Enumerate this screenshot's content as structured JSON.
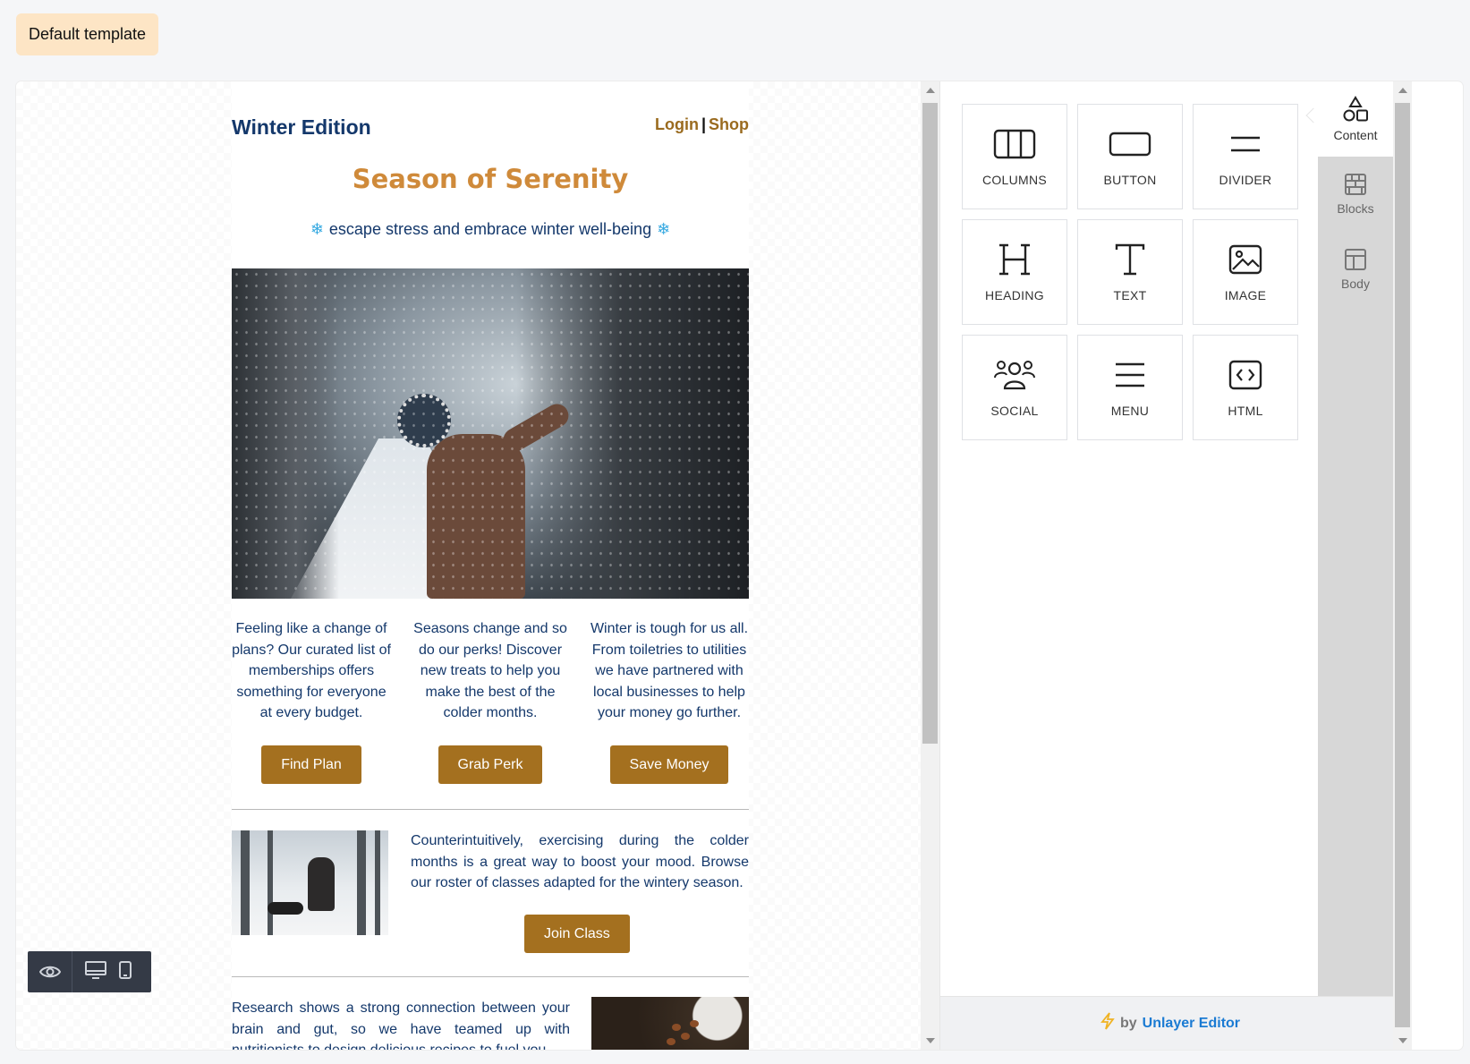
{
  "header": {
    "template_label": "Default template"
  },
  "email": {
    "brand": "Winter Edition",
    "login_link": "Login",
    "separator": "|",
    "shop_link": "Shop",
    "headline": "Season of Serenity",
    "tagline": "escape stress and embrace winter well-being",
    "tagline_icon": "❄",
    "columns": [
      {
        "text": "Feeling like a change of plans? Our curated list of memberships offers something for everyone at every budget.",
        "button": "Find Plan"
      },
      {
        "text": "Seasons change and so do our perks! Discover new treats to help you make the best of the colder months.",
        "button": "Grab Perk"
      },
      {
        "text": "Winter is tough for us all. From toiletries to utilities we have partnered with local businesses to help your money go further.",
        "button": "Save Money"
      }
    ],
    "exercise": {
      "text": "Counterintuitively, exercising during the colder months is a great way to boost your mood. Browse our roster of classes adapted for the wintery season.",
      "button": "Join Class"
    },
    "research": {
      "text": "Research shows a strong connection between your brain and gut, so we have teamed up with nutritionists to design delicious recipes to fuel you"
    }
  },
  "tools": [
    {
      "label": "COLUMNS",
      "icon": "columns-icon"
    },
    {
      "label": "BUTTON",
      "icon": "button-icon"
    },
    {
      "label": "DIVIDER",
      "icon": "divider-icon"
    },
    {
      "label": "HEADING",
      "icon": "heading-icon"
    },
    {
      "label": "TEXT",
      "icon": "text-icon"
    },
    {
      "label": "IMAGE",
      "icon": "image-icon"
    },
    {
      "label": "SOCIAL",
      "icon": "social-icon"
    },
    {
      "label": "MENU",
      "icon": "menu-icon"
    },
    {
      "label": "HTML",
      "icon": "html-icon"
    }
  ],
  "tabs": [
    {
      "label": "Content",
      "icon": "shapes-icon"
    },
    {
      "label": "Blocks",
      "icon": "blocks-icon"
    },
    {
      "label": "Body",
      "icon": "layout-icon"
    }
  ],
  "footer": {
    "by": "by",
    "brand": "Unlayer Editor"
  },
  "colors": {
    "accent": "#a4701f",
    "brand_blue": "#14386b",
    "headline": "#cf8a3a",
    "link": "#1b7bd3"
  }
}
